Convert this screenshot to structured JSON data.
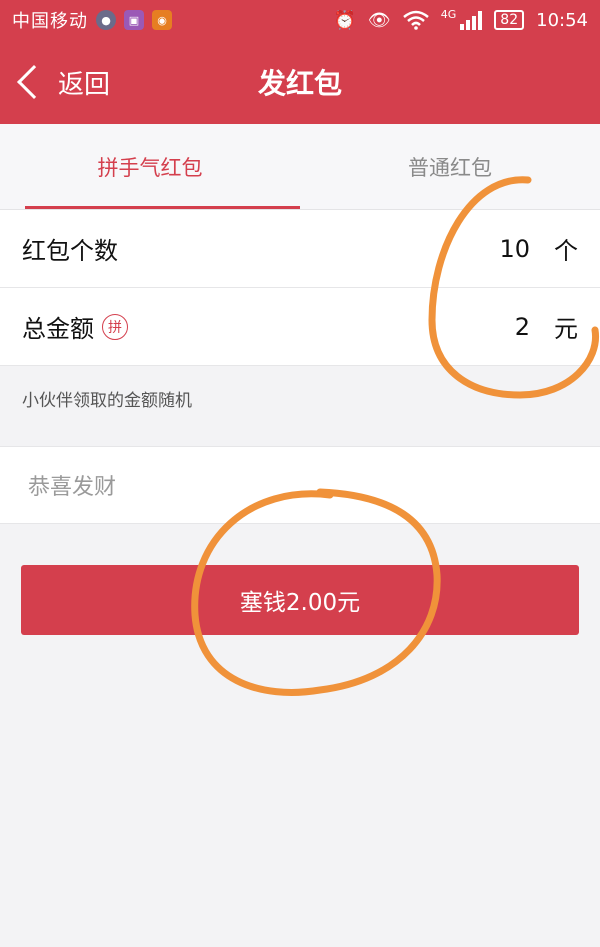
{
  "status_bar": {
    "carrier": "中国移动",
    "network": "4G",
    "battery": "82",
    "time": "10:54"
  },
  "header": {
    "back_label": "返回",
    "title": "发红包"
  },
  "tabs": [
    {
      "label": "拼手气红包",
      "active": true
    },
    {
      "label": "普通红包",
      "active": false
    }
  ],
  "form": {
    "count": {
      "label": "红包个数",
      "value": "10",
      "unit": "个"
    },
    "amount": {
      "label": "总金额",
      "badge": "拼",
      "value": "2",
      "unit": "元"
    }
  },
  "hint": "小伙伴领取的金额随机",
  "greeting": {
    "placeholder": "恭喜发财"
  },
  "send_button": {
    "label": "塞钱2.00元"
  },
  "colors": {
    "brand_red": "#d43f4d",
    "annotation_orange": "#f0923a"
  }
}
